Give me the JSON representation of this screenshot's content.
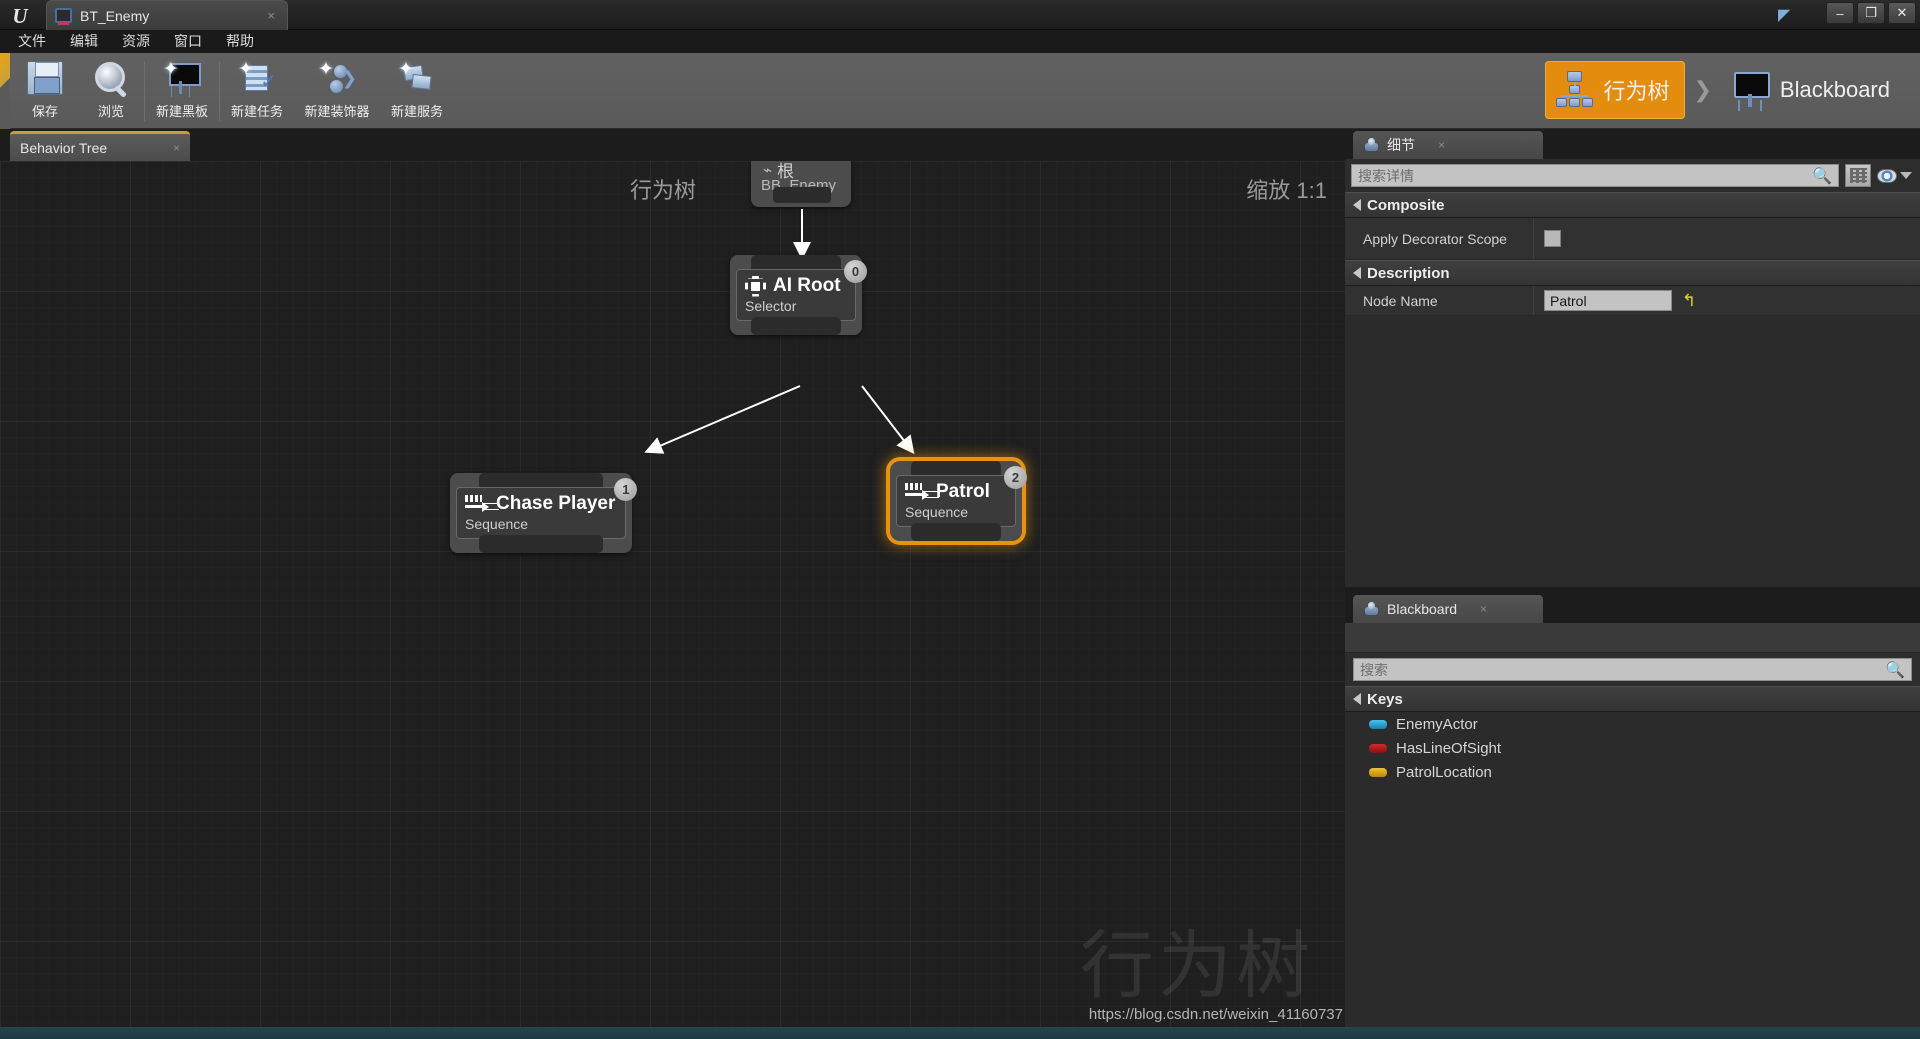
{
  "window": {
    "app_icon": "unreal-logo-icon",
    "tab_title": "BT_Enemy",
    "tab_close": "×",
    "minimize": "–",
    "restore": "❐",
    "close": "✕"
  },
  "menubar": {
    "items": [
      {
        "label": "文件",
        "name": "menu-file"
      },
      {
        "label": "编辑",
        "name": "menu-edit"
      },
      {
        "label": "资源",
        "name": "menu-assets"
      },
      {
        "label": "窗口",
        "name": "menu-window"
      },
      {
        "label": "帮助",
        "name": "menu-help"
      }
    ]
  },
  "toolbar": {
    "buttons": [
      {
        "label": "保存",
        "icon": "floppy-disk-icon"
      },
      {
        "label": "浏览",
        "icon": "magnifier-icon"
      },
      {
        "label": "新建黑板",
        "icon": "new-blackboard-icon"
      },
      {
        "label": "新建任务",
        "icon": "new-task-icon"
      },
      {
        "label": "新建装饰器",
        "icon": "new-decorator-icon"
      },
      {
        "label": "新建服务",
        "icon": "new-service-icon"
      }
    ],
    "modes": {
      "behavior_tree": "行为树",
      "separator": "❯",
      "blackboard": "Blackboard",
      "active": "behavior_tree",
      "active_color": "#e38c0e"
    }
  },
  "graph": {
    "tab_label": "Behavior Tree",
    "tab_close": "×",
    "overlay_title": "行为树",
    "overlay_zoom": "缩放 1:1",
    "watermark": "行为树",
    "url_watermark": "https://blog.csdn.net/weixin_41160737",
    "root_node": {
      "label": "根",
      "asset": "BB_Enemy"
    },
    "nodes": [
      {
        "title": "AI Root",
        "subtitle": "Selector",
        "index": "0",
        "icon": "selector-icon",
        "selected": false
      },
      {
        "title": "Chase Player",
        "subtitle": "Sequence",
        "index": "1",
        "icon": "sequence-icon",
        "selected": false
      },
      {
        "title": "Patrol",
        "subtitle": "Sequence",
        "index": "2",
        "icon": "sequence-icon",
        "selected": true
      }
    ]
  },
  "details_panel": {
    "tab_label": "细节",
    "tab_close": "×",
    "search_placeholder": "搜索详情",
    "search_value": "",
    "view_options_icon": "eye-icon",
    "grid_toggle_icon": "grid-view-icon",
    "sections": [
      {
        "title": "Composite",
        "rows": [
          {
            "name": "Apply Decorator Scope",
            "type": "checkbox",
            "value": ""
          }
        ]
      },
      {
        "title": "Description",
        "rows": [
          {
            "name": "Node Name",
            "type": "text",
            "value": "Patrol",
            "revert_icon": "↰"
          }
        ]
      }
    ]
  },
  "blackboard_panel": {
    "tab_label": "Blackboard",
    "tab_close": "×",
    "search_placeholder": "搜索",
    "search_value": "",
    "section_title": "Keys",
    "keys": [
      {
        "name": "EnemyActor",
        "color": "#2f9fd6"
      },
      {
        "name": "HasLineOfSight",
        "color": "#b31b1b"
      },
      {
        "name": "PatrolLocation",
        "color": "#d9a114"
      }
    ]
  }
}
